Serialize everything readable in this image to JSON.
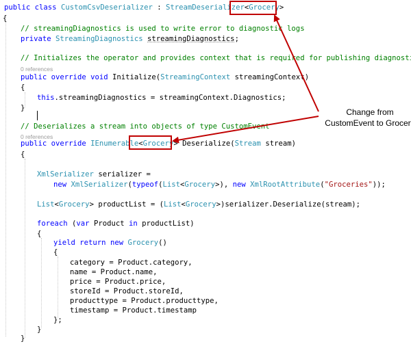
{
  "code": {
    "class_decl": {
      "kw1": "public",
      "kw2": "class",
      "name": "CustomCsvDeserializer",
      "sep": " : ",
      "base": "StreamDeserializer",
      "lt": "<",
      "generic": "Grocery",
      "gt": ">"
    },
    "brace_open_class": "{",
    "comment_diag": "// streamingDiagnostics is used to write error to diagnostic logs",
    "field_decl": {
      "kw": "private",
      "type": "StreamingDiagnostics",
      "name": "streamingDiagnostics",
      "semi": ";"
    },
    "comment_init": "// Initializes the operator and provides context that is required for publishing diagnostics",
    "refs_1": "0 references",
    "init_decl": {
      "kw1": "public",
      "kw2": "override",
      "kw3": "void",
      "name": "Initialize",
      "open": "(",
      "type": "StreamingContext",
      "param": "streamingContext",
      "close": ")"
    },
    "brace_open_init": "{",
    "assign": {
      "kw": "this",
      "rest": ".streamingDiagnostics = streamingContext.Diagnostics;"
    },
    "brace_close_init": "}",
    "comment_deser": "// Deserializes a stream into objects of type CustomEvent",
    "refs_2": "0 references",
    "deser_decl": {
      "kw1": "public",
      "kw2": "override",
      "type": "IEnumerable",
      "lt": "<",
      "generic": "Grocery",
      "gt": ">",
      "name": "Deserialize",
      "open": "(",
      "ptype": "Stream",
      "param": "stream",
      "close": ")"
    },
    "brace_open_deser": "{",
    "serializer_line1": {
      "type": "XmlSerializer",
      "rest": "serializer ="
    },
    "serializer_line2": {
      "kw1": "new",
      "t1": "XmlSerializer",
      "p1": "(",
      "kw2": "typeof",
      "p2": "(",
      "t2": "List",
      "lt": "<",
      "t3": "Grocery",
      "gt": ">), ",
      "kw3": "new",
      "t4": "XmlRootAttribute",
      "p3": "(",
      "str": "\"Groceries\"",
      "end": "));"
    },
    "list_line": {
      "t1": "List",
      "lt1": "<",
      "t2": "Grocery",
      "gt1": ">",
      "mid": " productList = (",
      "t3": "List",
      "lt2": "<",
      "t4": "Grocery",
      "gt2": ">)serializer.Deserialize(stream);"
    },
    "foreach_line": {
      "kw1": "foreach",
      "p1": " (",
      "kw2": "var",
      "mid": " Product ",
      "kw3": "in",
      "rest": " productList)"
    },
    "brace_open_foreach": "{",
    "yield_line": {
      "kw1": "yield",
      "kw2": "return",
      "kw3": "new",
      "type": "Grocery",
      "rest": "()"
    },
    "brace_open_obj": "{",
    "props": [
      "category = Product.category,",
      "name = Product.name,",
      "price = Product.price,",
      "storeId = Product.storeId,",
      "producttype = Product.producttype,",
      "timestamp = Product.timestamp"
    ],
    "brace_close_obj": "};",
    "brace_close_foreach": "}",
    "brace_close_deser": "}"
  },
  "annotation": {
    "callout_line1": "Change from",
    "callout_line2": "CustomEvent to Grocery",
    "accent": "#c00000"
  }
}
